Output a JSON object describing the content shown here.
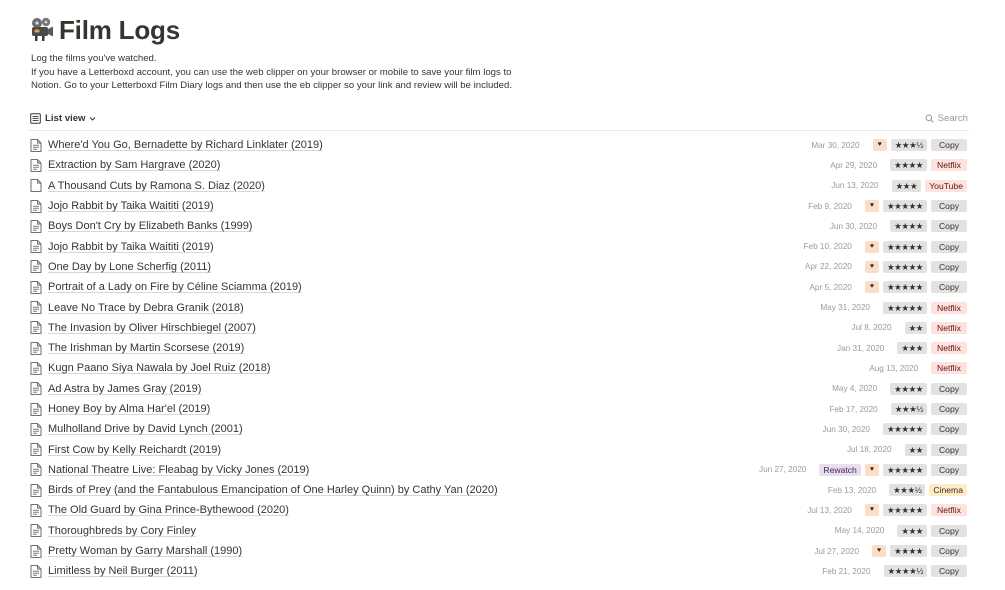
{
  "page": {
    "icon": "film-projector-icon",
    "title": "Film Logs",
    "description": [
      "Log the films you've watched.",
      "If you have a Letterboxd account, you can use the web clipper on your browser or mobile to save your film logs to",
      "Notion. Go to your Letterboxd Film Diary logs and then use the eb clipper so your link and review will be included."
    ]
  },
  "toolbar": {
    "view_label": "List view",
    "search_label": "Search"
  },
  "colors": {
    "copy": "#e3e2e0",
    "netflix": "#ffe2dd",
    "youtube": "#ffe2dd",
    "cinema": "#fdecc8",
    "fav": "#fadec9",
    "rewatch": "#e8deee"
  },
  "rows": [
    {
      "title": "Where'd You Go, Bernadette by Richard Linklater (2019)",
      "date": "Mar 30, 2020",
      "rewatch": "",
      "fav": true,
      "rating": "★★★½",
      "platform": "Copy"
    },
    {
      "title": "Extraction by Sam Hargrave (2020)",
      "date": "Apr 29, 2020",
      "rewatch": "",
      "fav": false,
      "rating": "★★★★",
      "platform": "Netflix"
    },
    {
      "title": "A Thousand Cuts by Ramona S. Diaz (2020)",
      "date": "Jun 13, 2020",
      "rewatch": "",
      "fav": false,
      "rating": "★★★",
      "platform": "YouTube"
    },
    {
      "title": "Jojo Rabbit by Taika Waititi (2019)",
      "date": "Feb 9, 2020",
      "rewatch": "",
      "fav": true,
      "rating": "★★★★★",
      "platform": "Copy"
    },
    {
      "title": "Boys Don't Cry by Elizabeth Banks (1999)",
      "date": "Jun 30, 2020",
      "rewatch": "",
      "fav": false,
      "rating": "★★★★",
      "platform": "Copy"
    },
    {
      "title": "Jojo Rabbit by Taika Waititi (2019)",
      "date": "Feb 10, 2020",
      "rewatch": "",
      "fav": true,
      "rating": "★★★★★",
      "platform": "Copy"
    },
    {
      "title": "One Day by Lone Scherfig (2011)",
      "date": "Apr 22, 2020",
      "rewatch": "",
      "fav": true,
      "rating": "★★★★★",
      "platform": "Copy"
    },
    {
      "title": "Portrait of a Lady on Fire by Céline Sciamma (2019)",
      "date": "Apr 5, 2020",
      "rewatch": "",
      "fav": true,
      "rating": "★★★★★",
      "platform": "Copy"
    },
    {
      "title": "Leave No Trace by Debra Granik (2018)",
      "date": "May 31, 2020",
      "rewatch": "",
      "fav": false,
      "rating": "★★★★★",
      "platform": "Netflix"
    },
    {
      "title": "The Invasion by Oliver Hirschbiegel (2007)",
      "date": "Jul 8, 2020",
      "rewatch": "",
      "fav": false,
      "rating": "★★",
      "platform": "Netflix"
    },
    {
      "title": "The Irishman by Martin Scorsese (2019)",
      "date": "Jan 31, 2020",
      "rewatch": "",
      "fav": false,
      "rating": "★★★",
      "platform": "Netflix"
    },
    {
      "title": "Kugn Paano Siya Nawala by Joel Ruiz (2018)",
      "date": "Aug 13, 2020",
      "rewatch": "",
      "fav": false,
      "rating": "",
      "platform": "Netflix"
    },
    {
      "title": "Ad Astra by James Gray (2019)",
      "date": "May 4, 2020",
      "rewatch": "",
      "fav": false,
      "rating": "★★★★",
      "platform": "Copy"
    },
    {
      "title": "Honey Boy by Alma Har'el (2019)",
      "date": "Feb 17, 2020",
      "rewatch": "",
      "fav": false,
      "rating": "★★★½",
      "platform": "Copy"
    },
    {
      "title": "Mulholland Drive by David Lynch (2001)",
      "date": "Jun 30, 2020",
      "rewatch": "",
      "fav": false,
      "rating": "★★★★★",
      "platform": "Copy"
    },
    {
      "title": "First Cow by Kelly Reichardt (2019)",
      "date": "Jul 18, 2020",
      "rewatch": "",
      "fav": false,
      "rating": "★★",
      "platform": "Copy"
    },
    {
      "title": "National Theatre Live: Fleabag by Vicky Jones (2019)",
      "date": "Jun 27, 2020",
      "rewatch": "Rewatch",
      "fav": true,
      "rating": "★★★★★",
      "platform": "Copy"
    },
    {
      "title": "Birds of Prey (and the Fantabulous Emancipation of One Harley Quinn) by Cathy Yan (2020)",
      "date": "Feb 13, 2020",
      "rewatch": "",
      "fav": false,
      "rating": "★★★½",
      "platform": "Cinema"
    },
    {
      "title": "The Old Guard by Gina Prince-Bythewood (2020)",
      "date": "Jul 13, 2020",
      "rewatch": "",
      "fav": true,
      "rating": "★★★★★",
      "platform": "Netflix"
    },
    {
      "title": "Thoroughbreds by Cory Finley",
      "date": "May 14, 2020",
      "rewatch": "",
      "fav": false,
      "rating": "★★★",
      "platform": "Copy"
    },
    {
      "title": "Pretty Woman by Garry Marshall (1990)",
      "date": "Jul 27, 2020",
      "rewatch": "",
      "fav": true,
      "rating": "★★★★",
      "platform": "Copy"
    },
    {
      "title": "Limitless by Neil Burger (2011)",
      "date": "Feb 21, 2020",
      "rewatch": "",
      "fav": false,
      "rating": "★★★★½",
      "platform": "Copy"
    }
  ]
}
